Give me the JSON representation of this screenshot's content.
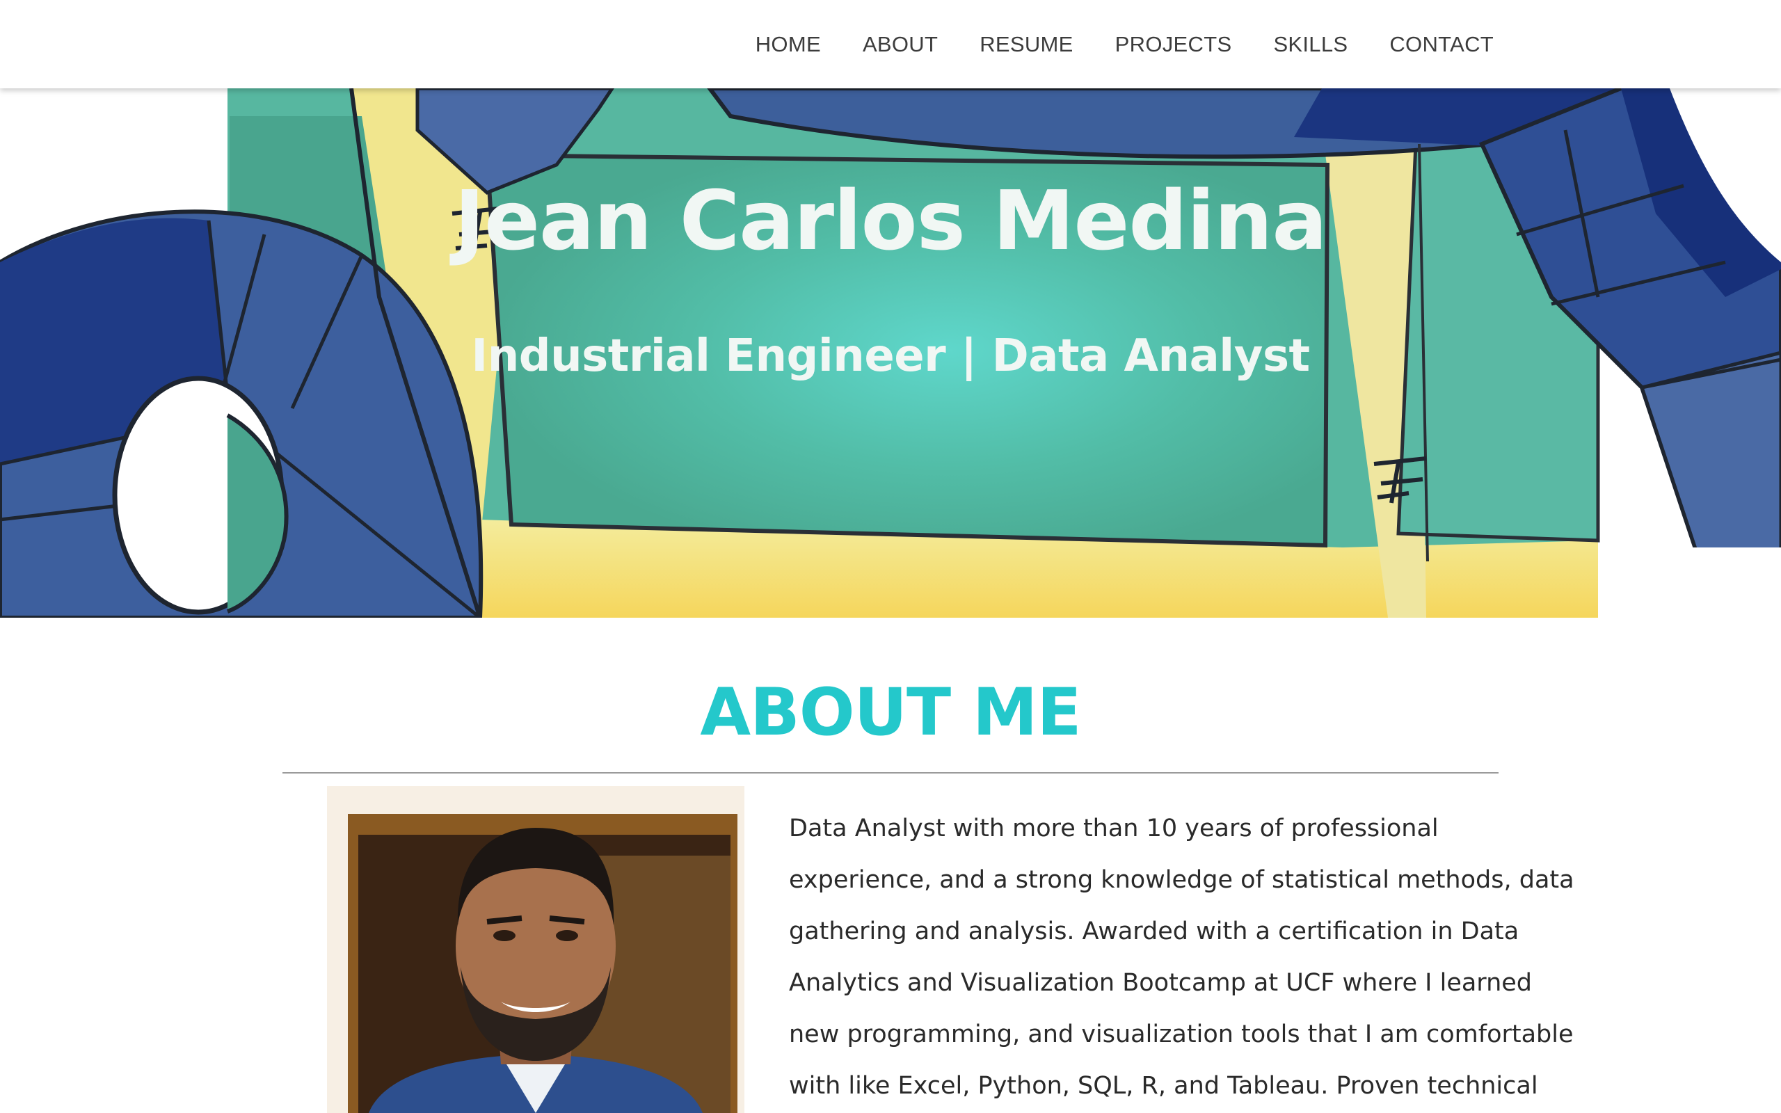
{
  "nav": {
    "items": [
      {
        "label": "HOME"
      },
      {
        "label": "ABOUT"
      },
      {
        "label": "RESUME"
      },
      {
        "label": "PROJECTS"
      },
      {
        "label": "SKILLS"
      },
      {
        "label": "CONTACT"
      }
    ]
  },
  "hero": {
    "title": "Jean Carlos Medina",
    "subtitle": "Industrial Engineer | Data Analyst",
    "colors": {
      "teal": "#58b9a3",
      "yellow": "#f2e590",
      "blue": "#4a6aa5",
      "navy": "#17307a"
    }
  },
  "about": {
    "heading": "ABOUT ME",
    "heading_color": "#24c8cb",
    "portrait_icon": "profile-photo",
    "lines": [
      "Data Analyst with more than 10 years of professional",
      "experience, and a strong knowledge of statistical methods, data",
      "gathering and analysis. Awarded with a certification in Data",
      "Analytics and Visualization Bootcamp at UCF where I learned",
      "new programming, and visualization tools that I am comfortable",
      "with like Excel, Python, SQL, R, and Tableau. Proven technical"
    ]
  }
}
